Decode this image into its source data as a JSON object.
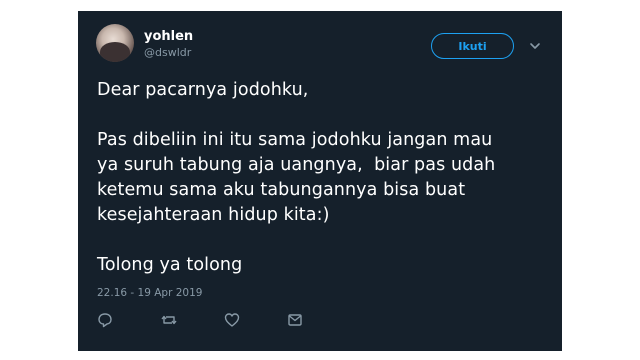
{
  "user": {
    "name": "yohlen",
    "handle": "@dswldr"
  },
  "follow_button": {
    "label": "Ikuti"
  },
  "menu": {
    "icon": "chevron-down-icon"
  },
  "tweet": {
    "paragraphs": [
      "Dear pacarnya jodohku,",
      "Pas dibeliin ini itu sama jodohku jangan mau\nya suruh tabung aja uangnya,  biar pas udah\nketemu sama aku tabungannya bisa buat\nkesejahteraan hidup kita:)",
      "Tolong ya tolong"
    ],
    "timestamp": "22.16 - 19 Apr 2019"
  },
  "actions": {
    "icons": [
      "reply-icon",
      "retweet-icon",
      "like-icon",
      "message-icon"
    ]
  },
  "colors": {
    "card_bg": "#15202b",
    "accent": "#1da1f2",
    "muted": "#8899a6",
    "text": "#ffffff"
  }
}
